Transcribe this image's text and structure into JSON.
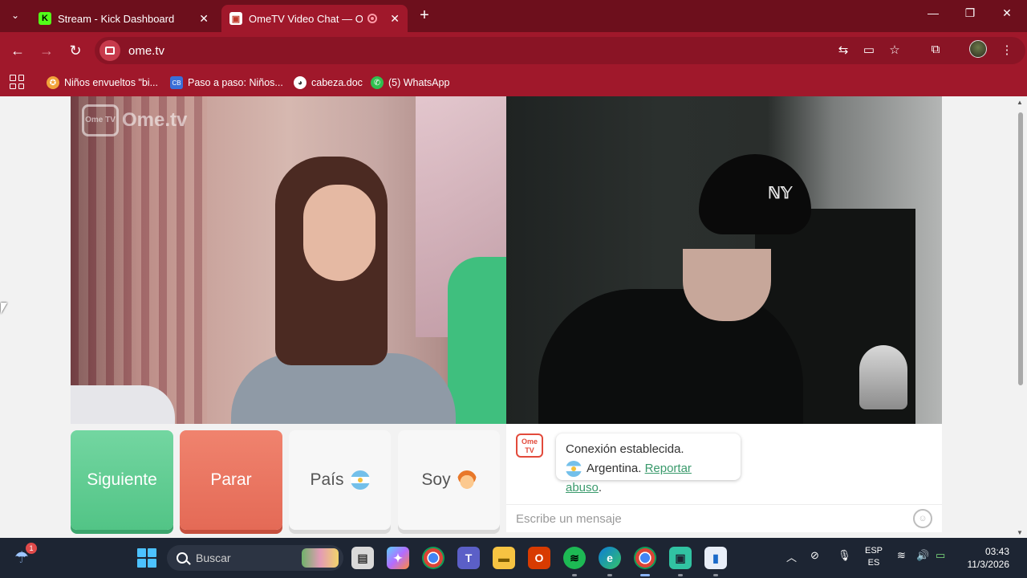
{
  "browser": {
    "tabs": [
      {
        "title": "Stream - Kick Dashboard",
        "favicon": "K"
      },
      {
        "title": "OmeTV Video Chat — Ome",
        "favicon": "▣"
      }
    ],
    "new_tab": "+",
    "close": "✕",
    "url": "ome.tv",
    "bookmarks": [
      {
        "label": "Niños envueltos \"bi...",
        "icon": "✪"
      },
      {
        "label": "Paso a paso: Niños...",
        "icon": "CB"
      },
      {
        "label": "cabeza.doc",
        "icon": "◕"
      },
      {
        "label": "(5) WhatsApp",
        "icon": "✆"
      }
    ],
    "colors": {
      "frame": "#6d0f1c",
      "toolbar": "#a0182b"
    }
  },
  "ometv": {
    "watermark_box": "Ome TV",
    "watermark_text": "Ome.tv",
    "buttons": {
      "next": "Siguiente",
      "stop": "Parar",
      "country": "País",
      "gender": "Soy"
    },
    "chat": {
      "logo": "Ome TV",
      "status": "Conexión establecida.",
      "country": "Argentina.",
      "report": "Reportar abuso",
      "report_suffix": ".",
      "placeholder": "Escribe un mensaje"
    },
    "colors": {
      "next": "#5fcb90",
      "stop": "#e8735e",
      "link": "#3a9a6c"
    }
  },
  "taskbar": {
    "weather_badge": "1",
    "search_label": "Buscar",
    "apps": [
      {
        "icon": "file-explorer-icon"
      },
      {
        "icon": "copilot-icon"
      },
      {
        "icon": "chrome-icon"
      },
      {
        "icon": "teams-icon"
      },
      {
        "icon": "folder-icon"
      },
      {
        "icon": "office-icon"
      },
      {
        "icon": "spotify-icon"
      },
      {
        "icon": "edge-icon"
      },
      {
        "icon": "chrome-profile-icon"
      },
      {
        "icon": "streamlabs-icon"
      },
      {
        "icon": "app-icon"
      }
    ],
    "lang_top": "ESP",
    "lang_bottom": "ES",
    "time": "03:43",
    "date": "11/3/2026"
  }
}
